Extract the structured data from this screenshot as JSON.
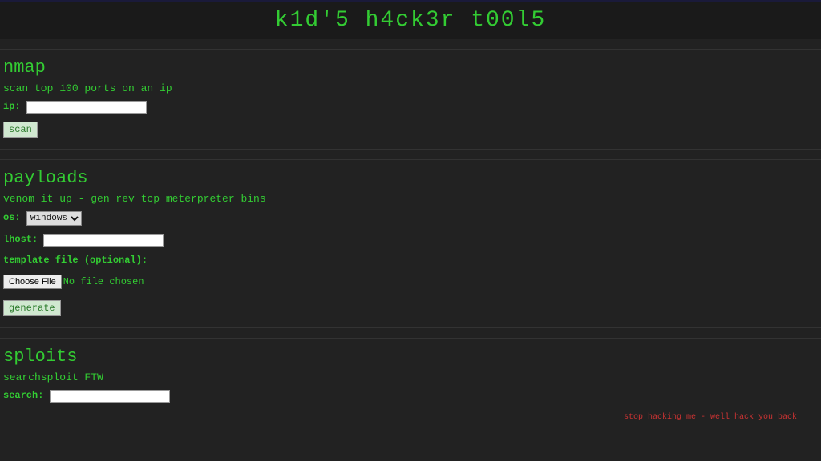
{
  "header": {
    "title": "k1d'5 h4ck3r t00l5"
  },
  "nmap": {
    "heading": "nmap",
    "desc": "scan top 100 ports on an ip",
    "ip_label": "ip:",
    "ip_value": "",
    "scan_button": "scan"
  },
  "payloads": {
    "heading": "payloads",
    "desc": "venom it up - gen rev tcp meterpreter bins",
    "os_label": "os:",
    "os_selected": "windows",
    "lhost_label": "lhost:",
    "lhost_value": "",
    "template_label": "template file (optional):",
    "choose_file_button": "Choose File",
    "file_status": "No file chosen",
    "generate_button": "generate"
  },
  "sploits": {
    "heading": "sploits",
    "desc": "searchsploit FTW",
    "search_label": "search:",
    "search_value": ""
  },
  "warning": "stop hacking me - well hack you back"
}
